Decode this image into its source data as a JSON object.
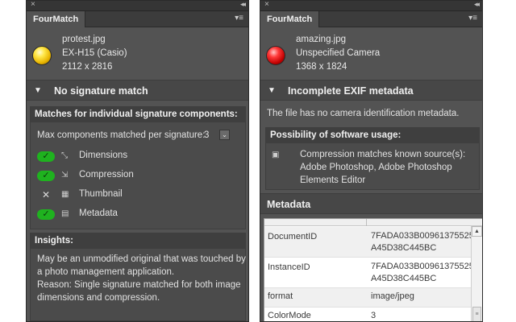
{
  "left_panel": {
    "close_glyph": "×",
    "collapse_glyph": "◂◂",
    "tab_label": "FourMatch",
    "menu_glyph": "▾≡",
    "file": {
      "name": "protest.jpg",
      "camera": "EX-H15 (Casio)",
      "dimensions": "2112 x 2816",
      "status_color": "#f2c200"
    },
    "section_title": "No signature match",
    "section_toggle": "▼",
    "components_box": {
      "title": "Matches for individual signature components:",
      "max_label": "Max components matched per signature:",
      "max_value": "3",
      "stepper_glyph": "⌄",
      "items": [
        {
          "label": "Dimensions",
          "matched": true,
          "mark": "✓",
          "icon": "⤡"
        },
        {
          "label": "Compression",
          "matched": true,
          "mark": "✓",
          "icon": "⇲"
        },
        {
          "label": "Thumbnail",
          "matched": false,
          "mark": "✕",
          "icon": "▦"
        },
        {
          "label": "Metadata",
          "matched": true,
          "mark": "✓",
          "icon": "▤"
        }
      ]
    },
    "insights": {
      "title": "Insights:",
      "text1": "May be an unmodified original that was touched by a photo management application.",
      "text2": "Reason: Single signature matched for both image dimensions and compression."
    }
  },
  "right_panel": {
    "close_glyph": "×",
    "collapse_glyph": "◂◂",
    "tab_label": "FourMatch",
    "menu_glyph": "▾≡",
    "file": {
      "name": "amazing.jpg",
      "camera": "Unspecified Camera",
      "dimensions": "1368 x 1824",
      "status_color": "#e01010"
    },
    "section_title": "Incomplete EXIF metadata",
    "section_toggle": "▼",
    "no_camera_text": "The file has no camera identification metadata.",
    "software_box": {
      "title": "Possibility of software usage:",
      "icon": "▣",
      "line1": "Compression matches known source(s):",
      "line2": "Adobe Photoshop, Adobe Photoshop",
      "line3": "Elements Editor"
    },
    "metadata_title": "Metadata",
    "scroll_up_glyph": "▲",
    "scroll_thumb_glyph": "≡",
    "metadata_rows": [
      {
        "key": "DocumentID",
        "value1": "7FADA033B00961375525",
        "value2": "A45D38C445BC"
      },
      {
        "key": "InstanceID",
        "value1": "7FADA033B00961375525",
        "value2": "A45D38C445BC"
      },
      {
        "key": "format",
        "value1": "image/jpeg",
        "value2": ""
      },
      {
        "key": "ColorMode",
        "value1": "3",
        "value2": ""
      }
    ]
  }
}
